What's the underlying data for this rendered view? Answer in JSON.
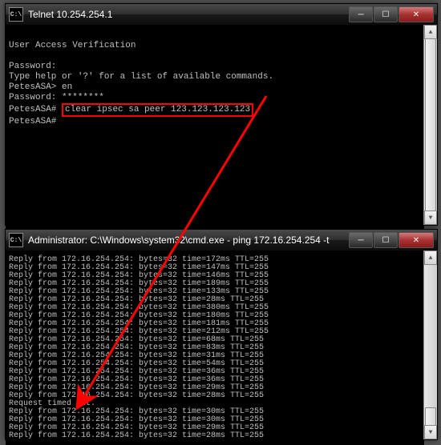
{
  "win1": {
    "title": "Telnet 10.254.254.1",
    "iconText": "C:\\",
    "body": {
      "l1": "User Access Verification",
      "l2": "Password:",
      "l3": "Type help or '?' for a list of available commands.",
      "l4": "PetesASA> en",
      "l5": "Password: ********",
      "l6a": "PetesASA#",
      "l6b": "clear ipsec sa peer 123.123.123.123",
      "l7": "PetesASA#"
    }
  },
  "win2": {
    "title": "Administrator: C:\\Windows\\system32\\cmd.exe - ping  172.16.254.254 -t",
    "iconText": "C:\\",
    "ping": [
      "Reply from 172.16.254.254: bytes=32 time=172ms TTL=255",
      "Reply from 172.16.254.254: bytes=32 time=147ms TTL=255",
      "Reply from 172.16.254.254: bytes=32 time=146ms TTL=255",
      "Reply from 172.16.254.254: bytes=32 time=189ms TTL=255",
      "Reply from 172.16.254.254: bytes=32 time=133ms TTL=255",
      "Reply from 172.16.254.254: bytes=32 time=28ms TTL=255",
      "Reply from 172.16.254.254: bytes=32 time=380ms TTL=255",
      "Reply from 172.16.254.254: bytes=32 time=180ms TTL=255",
      "Reply from 172.16.254.254: bytes=32 time=181ms TTL=255",
      "Reply from 172.16.254.254: bytes=32 time=212ms TTL=255",
      "Reply from 172.16.254.254: bytes=32 time=68ms TTL=255",
      "Reply from 172.16.254.254: bytes=32 time=83ms TTL=255",
      "Reply from 172.16.254.254: bytes=32 time=31ms TTL=255",
      "Reply from 172.16.254.254: bytes=32 time=54ms TTL=255",
      "Reply from 172.16.254.254: bytes=32 time=36ms TTL=255",
      "Reply from 172.16.254.254: bytes=32 time=36ms TTL=255",
      "Reply from 172.16.254.254: bytes=32 time=29ms TTL=255",
      "Reply from 172.16.254.254: bytes=32 time=28ms TTL=255",
      "Request timed out.",
      "Reply from 172.16.254.254: bytes=32 time=30ms TTL=255",
      "Reply from 172.16.254.254: bytes=32 time=30ms TTL=255",
      "Reply from 172.16.254.254: bytes=32 time=29ms TTL=255",
      "Reply from 172.16.254.254: bytes=32 time=28ms TTL=255"
    ]
  },
  "colors": {
    "highlight": "#ff0000"
  }
}
